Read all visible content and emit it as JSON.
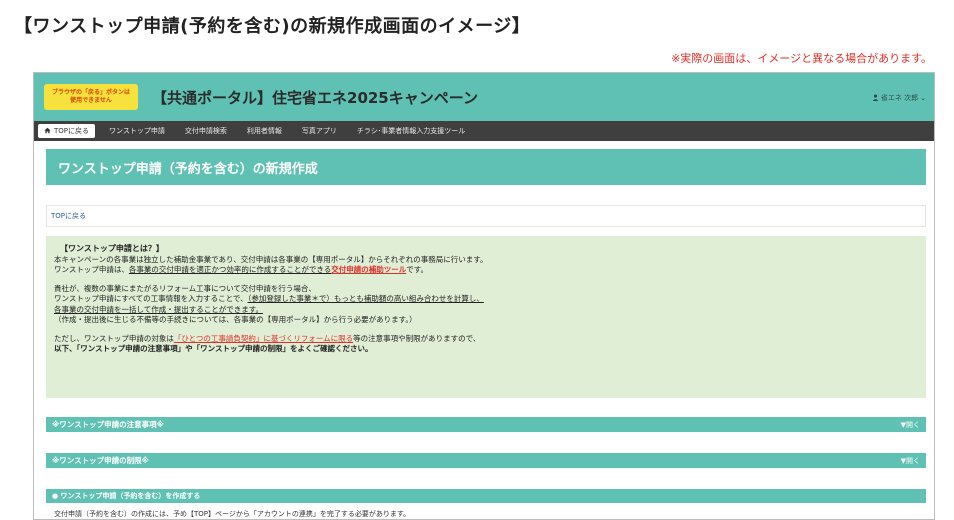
{
  "page": {
    "heading": "【ワンストップ申請(予約を含む)の新規作成画面のイメージ】",
    "note": "※実際の画面は、イメージと異なる場合があります。"
  },
  "portal": {
    "back_warning": "ブラウザの「戻る」ボタンは\n使用できません",
    "title": "【共通ポータル】住宅省エネ2025キャンペーン",
    "user_icon": "user-icon",
    "user_name": "省エネ 次郎",
    "user_caret": "⌄"
  },
  "nav": {
    "top_icon": "home-icon",
    "top_label": "TOPに戻る",
    "items": [
      "ワンストップ申請",
      "交付申請検索",
      "利用者情報",
      "写真アプリ",
      "チラシ･事業者情報入力支援ツール"
    ]
  },
  "main": {
    "title": "ワンストップ申請（予約を含む）の新規作成",
    "top_link": "TOPに戻る"
  },
  "info": {
    "title": "【ワンストップ申請とは？】",
    "l1": "本キャンペーンの各事業は独立した補助金事業であり、交付申請は各事業の【専用ポータル】からそれぞれの事務局に行います。",
    "l2a": "ワンストップ申請は、",
    "l2b": "各事業の交付申請を適正かつ効率的に作成することができる",
    "l2c": "交付申請の補助ツール",
    "l2d": "です。",
    "l3": "貴社が、複数の事業にまたがるリフォーム工事について交付申請を行う場合、",
    "l4a": "ワンストップ申請にすべての工事情報を入力することで、",
    "l4b": "（参加登録した事業＊で）もっとも補助額の高い組み合わせを計算し、",
    "l5": "各事業の交付申請を一括して作成・提出することができます。",
    "l6": "（作成・提出後に生じる不備等の手続きについては、各事業の【専用ポータル】から行う必要があります。）",
    "l7a": "ただし、ワンストップ申請の対象は",
    "l7b": "「ひとつの工事請負契約」に基づくリフォームに限る",
    "l7c": "等の注意事項や制限がありますので、",
    "l8": "以下、「ワンストップ申請の注意事項」や「ワンストップ申請の制限」をよくご確認ください。"
  },
  "accordions": [
    {
      "label": "※ワンストップ申請の注意事項※",
      "toggle": "▼開く"
    },
    {
      "label": "※ワンストップ申請の制限※",
      "toggle": "▼開く"
    }
  ],
  "create": {
    "label": "● ワンストップ申請（予約を含む）を作成する",
    "note": "交付申請（予約を含む）の作成には、予め【TOP】ページから「アカウントの連携」を完了する必要があります。"
  },
  "colors": {
    "teal": "#5fc1b3",
    "nav_dark": "#3f3f3f",
    "info_green": "#dfeed5",
    "warning_yellow": "#f7e13c",
    "alert_red": "#e0302a"
  }
}
